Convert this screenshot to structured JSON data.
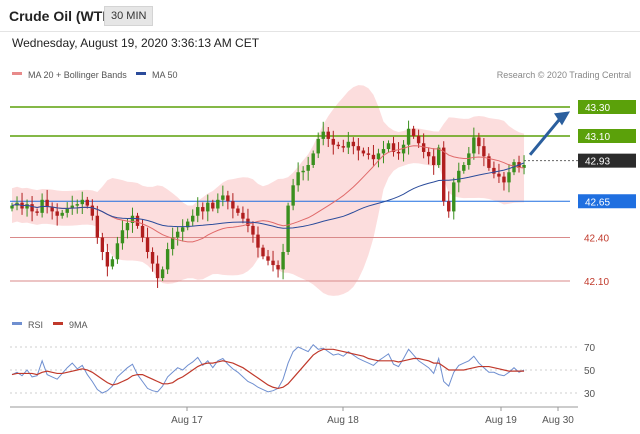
{
  "header": {
    "title": "Crude Oil (WTI)",
    "timeframe": "30 MIN",
    "datetime": "Wednesday, August 19, 2020 3:36:13 AM CET"
  },
  "colors": {
    "ma20": "#e06a6a",
    "ma50": "#2b4c9b",
    "bands": "#fbd2d2",
    "bull": "#3a8f1e",
    "bear": "#b01e1e",
    "resistance": "#5ba10a",
    "current": "#2b2b2b",
    "pivot": "#1f6fe0",
    "support": "#d98a8a",
    "arrow": "#2b5f9e",
    "rsi": "#6f8fd0",
    "rsi_ma": "#c0392b"
  },
  "chart_data": [
    {
      "type": "candlestick",
      "legend": [
        "MA 20 + Bollinger Bands",
        "MA 50"
      ],
      "credit": "Research © 2020 Trading Central",
      "x_tick_labels": [
        "Aug 17",
        "Aug 18",
        "Aug 19",
        "Aug 30"
      ],
      "price_range": [
        42.0,
        43.4
      ],
      "levels": [
        {
          "label": "43.30",
          "value": 43.3,
          "kind": "resistance"
        },
        {
          "label": "43.10",
          "value": 43.1,
          "kind": "resistance"
        },
        {
          "label": "42.93",
          "value": 42.93,
          "kind": "current"
        },
        {
          "label": "42.65",
          "value": 42.65,
          "kind": "pivot"
        },
        {
          "label": "42.40",
          "value": 42.4,
          "kind": "support"
        },
        {
          "label": "42.10",
          "value": 42.1,
          "kind": "support"
        }
      ],
      "close": [
        42.62,
        42.64,
        42.6,
        42.63,
        42.58,
        42.57,
        42.66,
        42.61,
        42.58,
        42.55,
        42.57,
        42.6,
        42.62,
        42.63,
        42.66,
        42.62,
        42.55,
        42.4,
        42.3,
        42.2,
        42.25,
        42.36,
        42.45,
        42.5,
        42.55,
        42.48,
        42.4,
        42.3,
        42.22,
        42.12,
        42.18,
        42.32,
        42.4,
        42.44,
        42.47,
        42.51,
        42.55,
        42.61,
        42.58,
        42.64,
        42.6,
        42.66,
        42.69,
        42.65,
        42.6,
        42.57,
        42.53,
        42.48,
        42.42,
        42.33,
        42.27,
        42.24,
        42.21,
        42.18,
        42.3,
        42.62,
        42.76,
        42.85,
        42.86,
        42.9,
        42.98,
        43.08,
        43.13,
        43.08,
        43.04,
        43.03,
        43.02,
        43.06,
        43.03,
        43.0,
        42.98,
        42.97,
        42.94,
        42.98,
        43.01,
        43.05,
        42.99,
        42.98,
        43.04,
        43.15,
        43.1,
        43.05,
        42.99,
        42.96,
        42.9,
        43.02,
        42.65,
        42.58,
        42.78,
        42.86,
        42.9,
        42.98,
        43.09,
        43.03,
        42.96,
        42.88,
        42.84,
        42.82,
        42.78,
        42.85,
        42.92,
        42.88,
        42.9
      ]
    },
    {
      "type": "line",
      "legend": [
        "RSI",
        "9MA"
      ],
      "y_ticks": [
        70,
        50,
        30
      ],
      "rsi": [
        46,
        48,
        45,
        50,
        44,
        45,
        58,
        46,
        44,
        42,
        47,
        52,
        56,
        51,
        54,
        46,
        40,
        33,
        30,
        32,
        36,
        44,
        48,
        52,
        55,
        46,
        40,
        34,
        32,
        31,
        36,
        44,
        48,
        52,
        50,
        54,
        57,
        61,
        54,
        58,
        52,
        58,
        60,
        55,
        51,
        48,
        44,
        40,
        38,
        35,
        33,
        31,
        32,
        34,
        42,
        56,
        66,
        70,
        68,
        66,
        72,
        68,
        69,
        66,
        63,
        64,
        62,
        66,
        63,
        60,
        58,
        56,
        54,
        58,
        61,
        64,
        55,
        53,
        60,
        68,
        63,
        58,
        55,
        52,
        47,
        60,
        40,
        36,
        48,
        54,
        56,
        58,
        62,
        56,
        52,
        48,
        48,
        46,
        45,
        48,
        52,
        48,
        50
      ],
      "rsi_ma": [
        46,
        47,
        47,
        47,
        47,
        46,
        48,
        49,
        48,
        47,
        47,
        48,
        49,
        50,
        51,
        50,
        48,
        45,
        42,
        39,
        37,
        38,
        40,
        42,
        45,
        46,
        46,
        44,
        42,
        40,
        38,
        38,
        39,
        42,
        44,
        47,
        50,
        53,
        55,
        56,
        56,
        57,
        58,
        57,
        56,
        54,
        52,
        49,
        46,
        43,
        40,
        37,
        35,
        34,
        35,
        38,
        43,
        48,
        53,
        58,
        63,
        66,
        68,
        68,
        68,
        67,
        66,
        65,
        64,
        63,
        62,
        60,
        59,
        58,
        58,
        58,
        58,
        57,
        58,
        59,
        60,
        60,
        59,
        58,
        56,
        56,
        53,
        50,
        50,
        50,
        50,
        51,
        52,
        53,
        53,
        53,
        52,
        51,
        50,
        49,
        49,
        49,
        49
      ]
    }
  ]
}
